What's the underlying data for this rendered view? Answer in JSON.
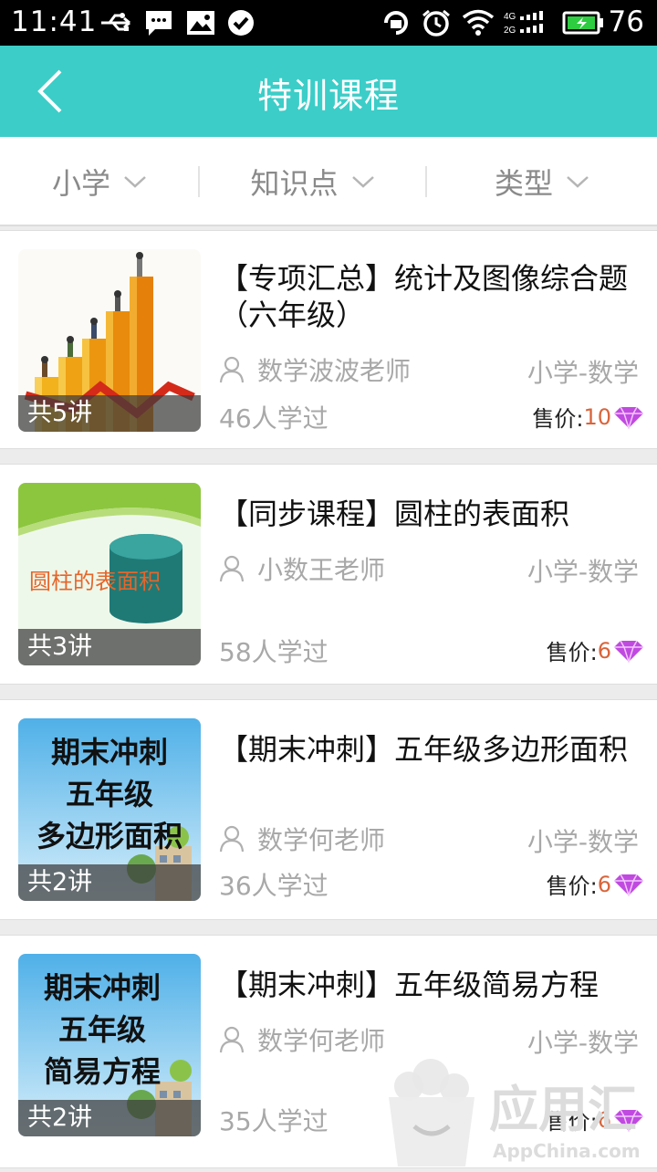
{
  "status_bar": {
    "time": "11:41",
    "battery": "76",
    "network": "4G 2G"
  },
  "header": {
    "title": "特训课程"
  },
  "filters": [
    {
      "label": "小学"
    },
    {
      "label": "知识点"
    },
    {
      "label": "类型"
    }
  ],
  "courses": [
    {
      "title": "【专项汇总】统计及图像综合题（六年级）",
      "teacher": "数学波波老师",
      "subject": "小学-数学",
      "lessons": "共5讲",
      "learners": "46人学过",
      "price_label": "售价:",
      "price": "10"
    },
    {
      "title": "【同步课程】圆柱的表面积",
      "teacher": "小数王老师",
      "subject": "小学-数学",
      "lessons": "共3讲",
      "learners": "58人学过",
      "price_label": "售价:",
      "price": "6",
      "thumb_text": "圆柱的表面积"
    },
    {
      "title": "【期末冲刺】五年级多边形面积",
      "teacher": "数学何老师",
      "subject": "小学-数学",
      "lessons": "共2讲",
      "learners": "36人学过",
      "price_label": "售价:",
      "price": "6",
      "thumb_lines": [
        "期末冲刺",
        "五年级",
        "多边形面积"
      ]
    },
    {
      "title": "【期末冲刺】五年级简易方程",
      "teacher": "数学何老师",
      "subject": "小学-数学",
      "lessons": "共2讲",
      "learners": "35人学过",
      "price_label": "售价:",
      "price": "6",
      "thumb_lines": [
        "期末冲刺",
        "五年级",
        "简易方程"
      ]
    }
  ],
  "watermark": {
    "brand": "应用汇",
    "domain": "AppChina.com"
  },
  "colors": {
    "header": "#3ccdc8",
    "price": "#d9643a",
    "diamond": "#c04ae0"
  }
}
